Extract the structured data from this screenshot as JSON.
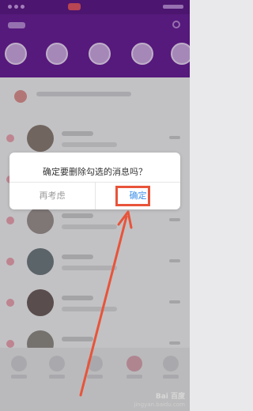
{
  "dialog": {
    "message": "确定要删除勾选的消息吗？",
    "cancel_label": "再考虑",
    "confirm_label": "确定"
  },
  "colors": {
    "header_purple": "#6a1f98",
    "confirm_blue": "#3e8fe8",
    "highlight_red": "#e8543a"
  },
  "watermark": {
    "logo": "Bai 百度",
    "site": "jingyan.baidu.com"
  }
}
